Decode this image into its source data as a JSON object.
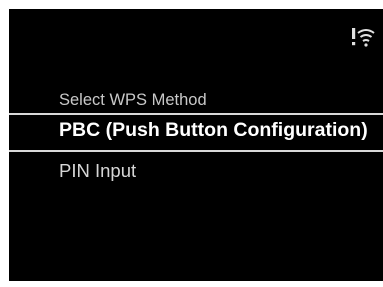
{
  "status_bar": {
    "icons": [
      "wifi-alert-icon"
    ],
    "icon_color": "#e0e0e0"
  },
  "menu": {
    "title": "Select WPS Method",
    "selected_index": 0,
    "items": [
      {
        "label": "PBC (Push Button Configuration)",
        "selected": true
      },
      {
        "label": "PIN Input",
        "selected": false
      }
    ]
  },
  "colors": {
    "background": "#000000",
    "selected_text": "#ffffff",
    "text": "#d6d6d6",
    "divider": "#d9d9d9"
  }
}
